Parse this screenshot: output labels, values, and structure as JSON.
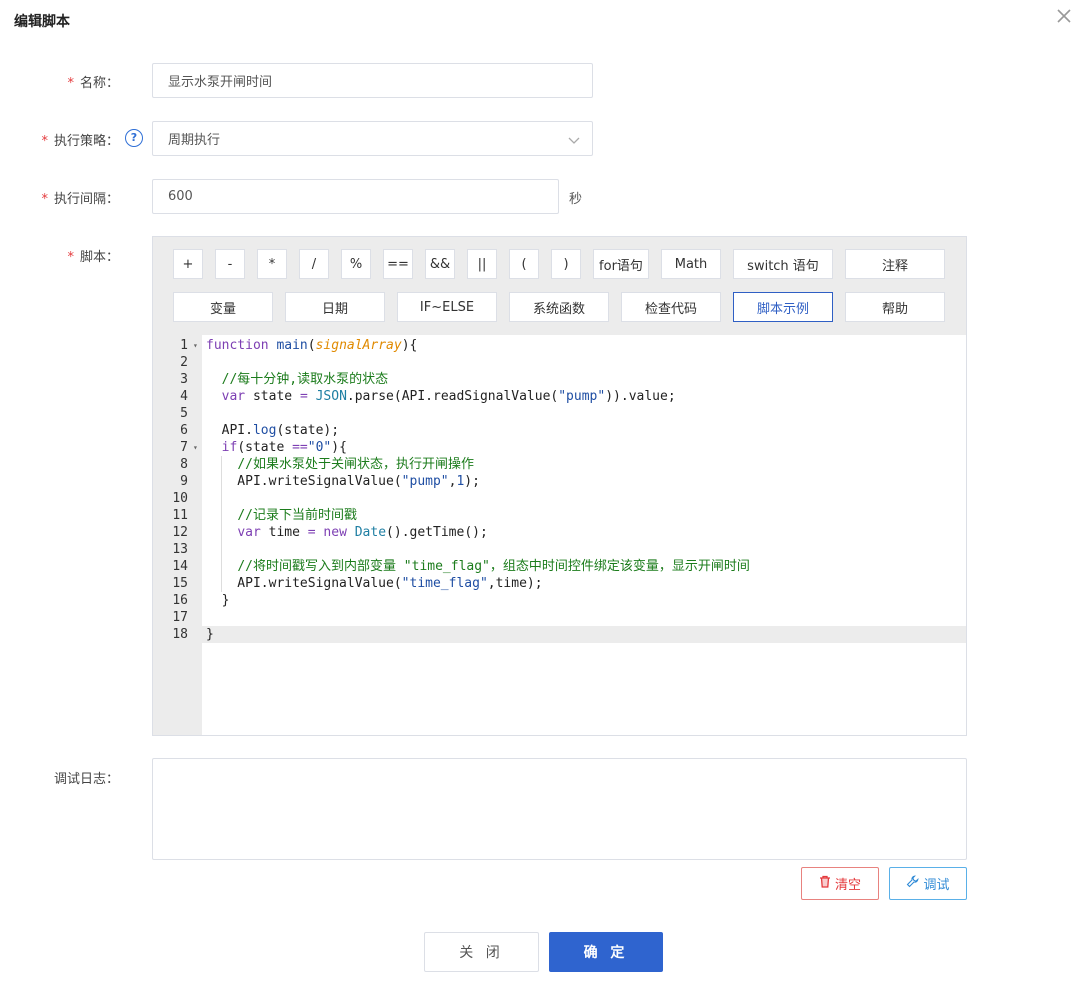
{
  "dialog": {
    "title": "编辑脚本"
  },
  "form": {
    "required_mark": "*",
    "name_label": "名称：",
    "name_value": "显示水泵开闸时间",
    "strategy_label": "执行策略：",
    "strategy_help_icon": "question-circle-icon",
    "strategy_value": "周期执行",
    "interval_label": "执行间隔：",
    "interval_value": "600",
    "interval_unit": "秒",
    "script_label": "脚本：",
    "log_label": "调试日志：",
    "log_value": ""
  },
  "toolbar": {
    "row1": [
      "+",
      "-",
      "*",
      "/",
      "%",
      "==",
      "&&",
      "||",
      "(",
      ")",
      "for语句",
      "Math",
      "switch 语句",
      "注释"
    ],
    "row2": [
      "变量",
      "日期",
      "IF~ELSE",
      "系统函数",
      "检查代码",
      "脚本示例",
      "帮助"
    ],
    "active": "脚本示例"
  },
  "editor": {
    "line_numbers": [
      "1",
      "2",
      "3",
      "4",
      "5",
      "6",
      "7",
      "8",
      "9",
      "10",
      "11",
      "12",
      "13",
      "14",
      "15",
      "16",
      "17",
      "18"
    ],
    "active_line": 18,
    "lines": [
      [
        [
          "kw",
          "function "
        ],
        [
          "fn",
          "main"
        ],
        [
          "",
          "("
        ],
        [
          "param",
          "signalArray"
        ],
        [
          "",
          "){"
        ]
      ],
      [],
      [
        [
          "",
          "  "
        ],
        [
          "cm",
          "//每十分钟,读取水泵的状态"
        ]
      ],
      [
        [
          "",
          "  "
        ],
        [
          "kw",
          "var "
        ],
        [
          "",
          "state "
        ],
        [
          "op",
          "= "
        ],
        [
          "cls",
          "JSON"
        ],
        [
          "",
          ".parse(API.readSignalValue("
        ],
        [
          "str",
          "\"pump\""
        ],
        [
          "",
          "))."
        ],
        [
          "",
          "value;"
        ]
      ],
      [],
      [
        [
          "",
          "  API."
        ],
        [
          "prop",
          "log"
        ],
        [
          "",
          "(state);"
        ]
      ],
      [
        [
          "",
          "  "
        ],
        [
          "kw",
          "if"
        ],
        [
          "",
          "(state "
        ],
        [
          "op",
          "=="
        ],
        [
          "str",
          "\"0\""
        ],
        [
          "",
          "){"
        ]
      ],
      [
        [
          "",
          "    "
        ],
        [
          "cm",
          "//如果水泵处于关闸状态，执行开闸操作"
        ]
      ],
      [
        [
          "",
          "    API.writeSignalValue("
        ],
        [
          "str",
          "\"pump\""
        ],
        [
          "",
          ","
        ],
        [
          "num",
          "1"
        ],
        [
          "",
          ");"
        ]
      ],
      [],
      [
        [
          "",
          "    "
        ],
        [
          "cm",
          "//记录下当前时间戳"
        ]
      ],
      [
        [
          "",
          "    "
        ],
        [
          "kw",
          "var "
        ],
        [
          "",
          "time "
        ],
        [
          "op",
          "= "
        ],
        [
          "kw",
          "new "
        ],
        [
          "cls",
          "Date"
        ],
        [
          "",
          "()."
        ],
        [
          "",
          "getTime();"
        ]
      ],
      [],
      [
        [
          "",
          "    "
        ],
        [
          "cm",
          "//将时间戳写入到内部变量 \"time_flag\"，组态中时间控件绑定该变量，显示开闸时间"
        ]
      ],
      [
        [
          "",
          "    API.writeSignalValue("
        ],
        [
          "str",
          "\"time_flag\""
        ],
        [
          "",
          ",time);"
        ]
      ],
      [
        [
          "",
          "  }"
        ]
      ],
      [],
      [
        [
          "",
          "}"
        ]
      ]
    ]
  },
  "actions": {
    "clear_label": "清空",
    "clear_icon": "trash-icon",
    "debug_label": "调试",
    "debug_icon": "wrench-icon"
  },
  "footer": {
    "close_label": "关 闭",
    "ok_label": "确 定"
  },
  "colors": {
    "primary": "#2f64cf",
    "danger": "#e4393c",
    "info": "#2f8ad6",
    "required": "#e4393c"
  }
}
